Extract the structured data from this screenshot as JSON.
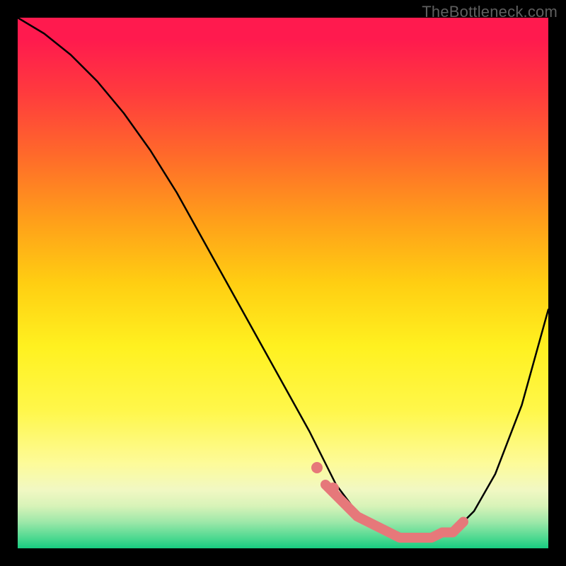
{
  "watermark": "TheBottleneck.com",
  "chart_data": {
    "type": "line",
    "title": "",
    "xlabel": "",
    "ylabel": "",
    "xlim": [
      0,
      100
    ],
    "ylim": [
      0,
      100
    ],
    "grid": false,
    "legend": "none",
    "background_gradient": {
      "top_color": "#ff1a4e",
      "bottom_color": "#18cc81",
      "meaning": "red = high bottleneck, green = low bottleneck"
    },
    "series": [
      {
        "name": "bottleneck-curve",
        "color": "#000000",
        "style": "solid",
        "x": [
          0,
          5,
          10,
          15,
          20,
          25,
          30,
          35,
          40,
          45,
          50,
          55,
          58,
          60,
          63,
          66,
          70,
          74,
          78,
          82,
          86,
          90,
          95,
          100
        ],
        "values": [
          100,
          97,
          93,
          88,
          82,
          75,
          67,
          58,
          49,
          40,
          31,
          22,
          16,
          12,
          8,
          5,
          3,
          2,
          2,
          3,
          7,
          14,
          27,
          45
        ]
      },
      {
        "name": "optimal-range-marker",
        "color": "#e6787a",
        "style": "thick",
        "x": [
          58,
          60,
          62,
          64,
          66,
          68,
          70,
          72,
          74,
          76,
          78,
          80,
          82,
          84
        ],
        "values": [
          12,
          10,
          8,
          6,
          5,
          4,
          3,
          2,
          2,
          2,
          2,
          3,
          3,
          5
        ]
      }
    ],
    "annotations": []
  }
}
